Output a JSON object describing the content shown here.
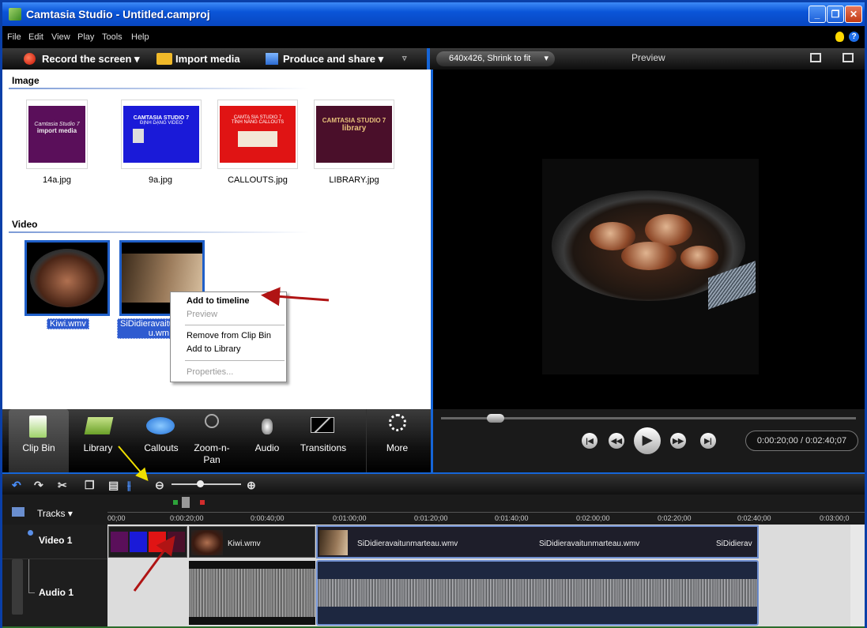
{
  "window": {
    "title": "Camtasia Studio - Untitled.camproj",
    "minimize": "_",
    "restore": "❐",
    "close": "✕"
  },
  "menu": [
    "File",
    "Edit",
    "View",
    "Play",
    "Tools",
    "Help"
  ],
  "help_icon": "?",
  "toolbar": {
    "record": "Record the screen ▾",
    "import": "Import media",
    "produce": "Produce and share ▾",
    "overflow": "▿"
  },
  "preview_header": {
    "size": "640x426, Shrink to fit",
    "label": "Preview"
  },
  "clip_bin": {
    "image_section": "Image",
    "video_section": "Video",
    "images": [
      {
        "name": "14a.jpg",
        "caption": "Camtasia Studio 7",
        "caption2": "import media",
        "color": "#5a0f5a"
      },
      {
        "name": "9a.jpg",
        "caption": "CAMTASIA STUDIO 7",
        "caption2": "ĐỊNH DẠNG VIDEO",
        "color": "#1a1ad8"
      },
      {
        "name": "CALLOUTS.jpg",
        "caption": "CAMTA SIA STUDIO 7",
        "caption2": "TÍNH NĂNG CALLOUTS",
        "color": "#e01414"
      },
      {
        "name": "LIBRARY.jpg",
        "caption": "CAMTASIA STUDIO 7",
        "caption2": "library",
        "color": "#4a0f2a"
      }
    ],
    "videos": [
      {
        "name": "Kiwi.wmv"
      },
      {
        "name_line1": "SiDidieravaitu",
        "name_line2": "u.wm"
      }
    ]
  },
  "context_menu": {
    "items": [
      "Add to timeline",
      "Preview",
      "Remove from Clip Bin",
      "Add to Library",
      "Properties..."
    ]
  },
  "tabs": [
    {
      "label": "Clip Bin"
    },
    {
      "label": "Library"
    },
    {
      "label": "Callouts"
    },
    {
      "label": "Zoom-n-\nPan"
    },
    {
      "label": "Audio"
    },
    {
      "label": "Transitions"
    },
    {
      "label": "More"
    }
  ],
  "player": {
    "timecode": "0:00:20;00 / 0:02:40;07",
    "position_fraction": 0.125
  },
  "timeline": {
    "tracks_btn": "Tracks ▾",
    "ticks": [
      "00;00",
      "0:00:20;00",
      "0:00:40;00",
      "0:01:00;00",
      "0:01:20;00",
      "0:01:40;00",
      "0:02:00;00",
      "0:02:20;00",
      "0:02:40;00",
      "0:03:00;0"
    ],
    "video_track": "Video 1",
    "audio_track": "Audio 1",
    "clips": {
      "kiwi": "Kiwi.wmv",
      "s1": "SiDidieravaitunmarteau.wmv",
      "s2": "SiDidieravaitunmarteau.wmv",
      "s3": "SiDidierav"
    }
  }
}
